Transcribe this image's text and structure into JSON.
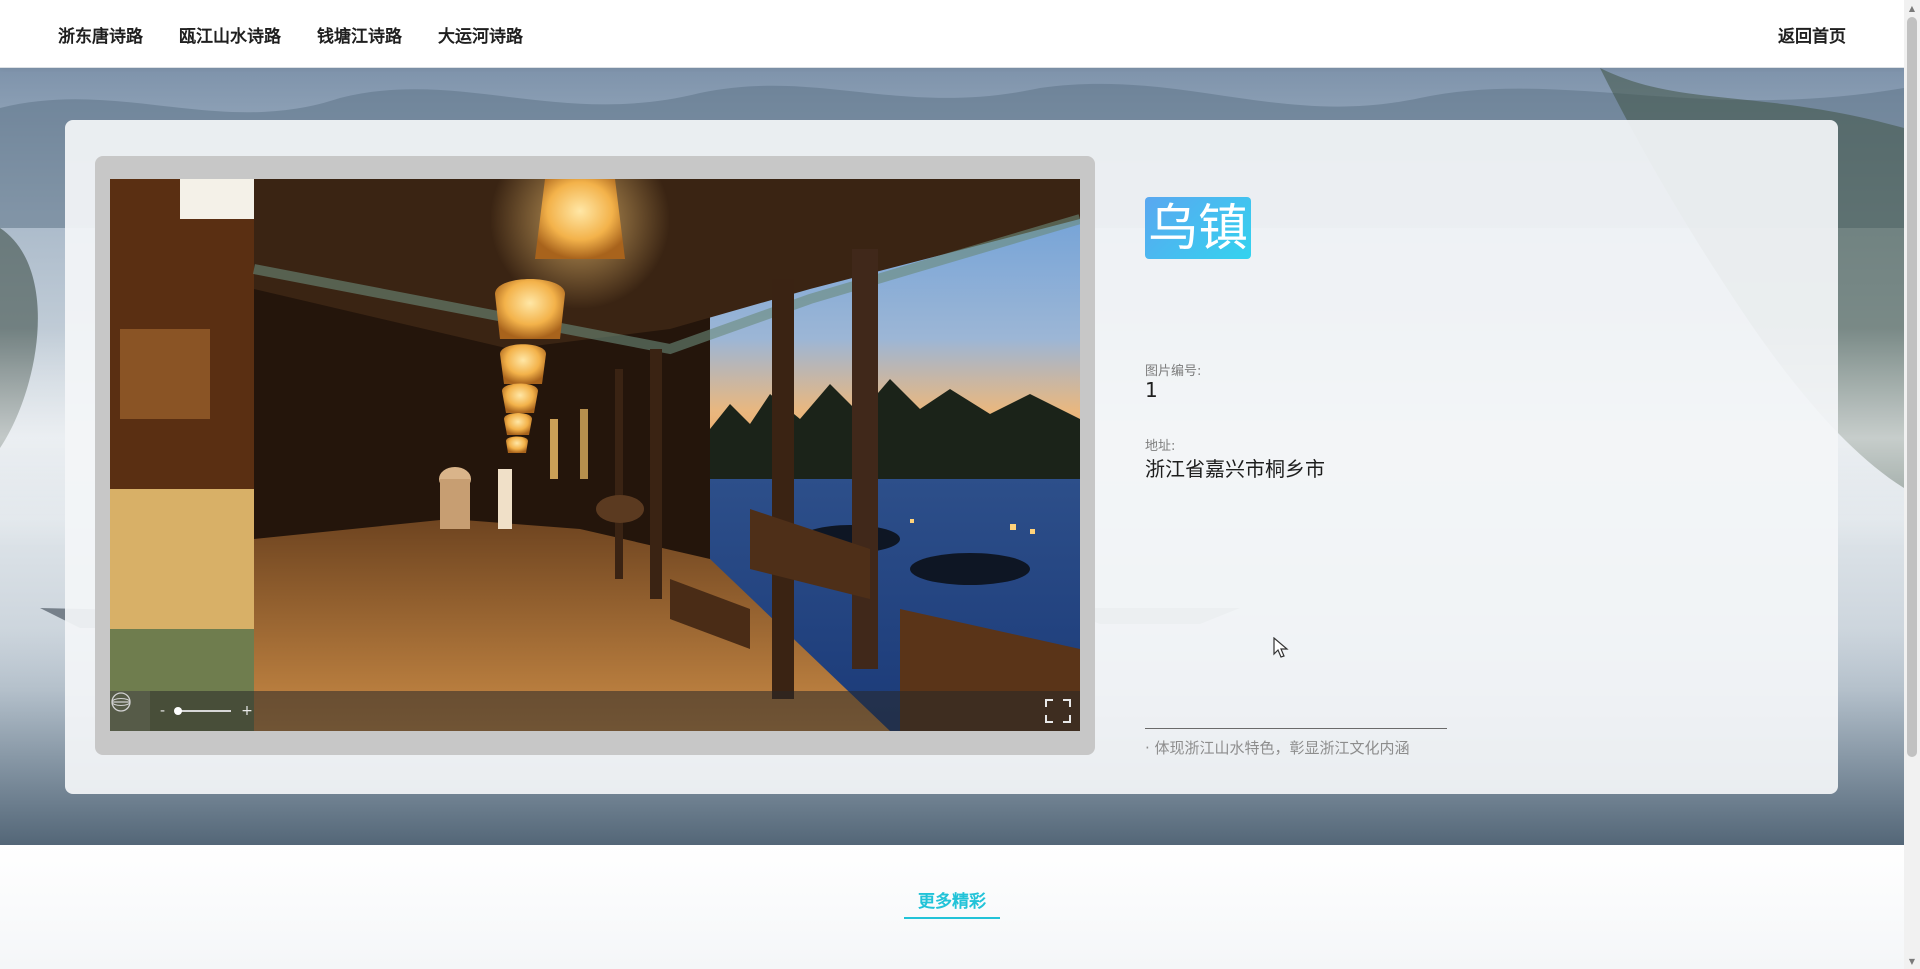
{
  "nav": {
    "items": [
      {
        "label": "浙东唐诗路"
      },
      {
        "label": "瓯江山水诗路"
      },
      {
        "label": "钱塘江诗路"
      },
      {
        "label": "大运河诗路"
      }
    ],
    "home_label": "返回首页"
  },
  "viewer": {
    "zoom_out_label": "-",
    "zoom_in_label": "+",
    "zoom_level": 0.05,
    "gyro_icon": "gyroscope-icon",
    "fullscreen_icon": "fullscreen-icon"
  },
  "place": {
    "title": "乌镇",
    "number_label": "图片编号:",
    "number_value": "1",
    "address_label": "地址:",
    "address_value": "浙江省嘉兴市桐乡市",
    "slogan": "· 体现浙江山水特色，彰显浙江文化内涵"
  },
  "more": {
    "title": "更多精彩"
  },
  "colors": {
    "accent": "#22c3d8",
    "title_gradient_start": "#5aa7f0",
    "title_gradient_end": "#33d3ef"
  }
}
